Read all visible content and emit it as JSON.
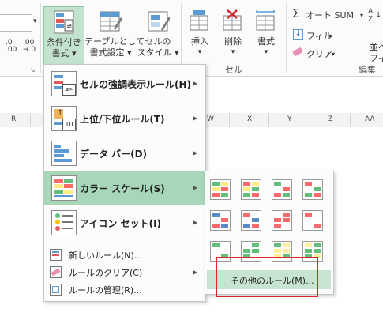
{
  "ribbon": {
    "number_dropdown_arrow": "▾",
    "decimal_increase": ".0\n.00",
    "decimal_decrease": ".00\n→.0",
    "corner_launcher": "↘",
    "conditional_formatting": {
      "line1": "条件付き",
      "line2": "書式 ▾"
    },
    "format_as_table": {
      "line1": "テーブルとして",
      "line2": "書式設定 ▾"
    },
    "cell_styles": {
      "line1": "セルの",
      "line2": "スタイル ▾"
    },
    "insert": {
      "line1": "挿入",
      "line2": "▾"
    },
    "delete": {
      "line1": "削除",
      "line2": "▾"
    },
    "format": {
      "line1": "書式",
      "line2": "▾"
    },
    "cells_group_label": "セル",
    "autosum": "オート SUM",
    "fill": "フィル",
    "clear": "クリア",
    "editing_group_label": "編集",
    "sort_filter": {
      "line1": "並べ",
      "line2": "フィ"
    },
    "dropdown_arrow": "▾"
  },
  "sheet": {
    "columns": [
      "R",
      "W",
      "X",
      "Y",
      "Z",
      "AA"
    ]
  },
  "menu": {
    "items": [
      {
        "label": "セルの強調表示ルール(H)"
      },
      {
        "label": "上位/下位ルール(T)"
      },
      {
        "label": "データ バー(D)"
      },
      {
        "label": "カラー スケール(S)"
      },
      {
        "label": "アイコン セット(I)"
      }
    ],
    "small_items": [
      {
        "label": "新しいルール(N)..."
      },
      {
        "label": "ルールのクリア(C)"
      },
      {
        "label": "ルールの管理(R)..."
      }
    ],
    "arrow": "▶",
    "icon_badges": {
      "highlight": "≤>",
      "topbottom": "10"
    }
  },
  "submenu": {
    "more_rules": "その他のルール(M)...",
    "swatches": [
      {
        "colors": [
          "#63be7b",
          "#ffeb84",
          "#f8696b"
        ]
      },
      {
        "colors": [
          "#f8696b",
          "#ffeb84",
          "#63be7b"
        ]
      },
      {
        "colors": [
          "#63be7b",
          "#fcfcff",
          "#f8696b"
        ]
      },
      {
        "colors": [
          "#f8696b",
          "#fcfcff",
          "#63be7b"
        ]
      },
      {
        "colors": [
          "#5a8ac6",
          "#fcfcff",
          "#f8696b"
        ]
      },
      {
        "colors": [
          "#f8696b",
          "#fcfcff",
          "#5a8ac6"
        ]
      },
      {
        "colors": [
          "#fcfcff",
          "#f8696b",
          "#f8696b"
        ]
      },
      {
        "colors": [
          "#f8696b",
          "#fcfcff",
          "#fcfcff"
        ]
      },
      {
        "colors": [
          "#63be7b",
          "#fcfcff",
          "#fcfcff"
        ]
      },
      {
        "colors": [
          "#fcfcff",
          "#63be7b",
          "#63be7b"
        ]
      },
      {
        "colors": [
          "#63be7b",
          "#ffef9c",
          "#ffef9c"
        ]
      },
      {
        "colors": [
          "#ffef9c",
          "#63be7b",
          "#63be7b"
        ]
      }
    ]
  },
  "colors": {
    "accent": "#217346",
    "selected_menu": "#a8d6b8",
    "highlight_box": "#d9262c"
  }
}
